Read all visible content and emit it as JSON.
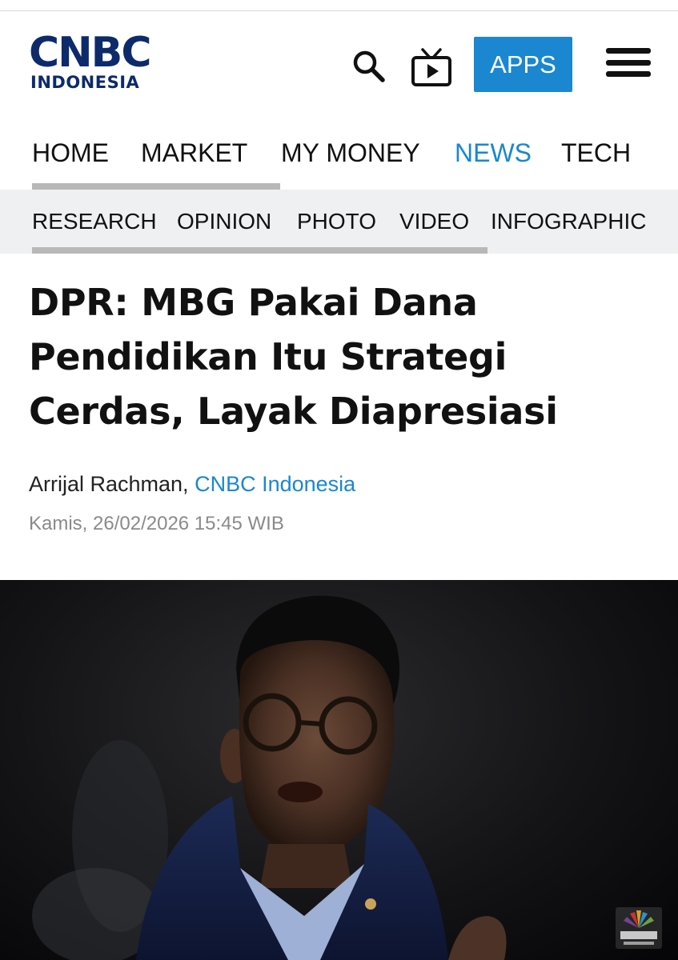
{
  "header": {
    "logo_top": "CNBC",
    "logo_bottom": "INDONESIA",
    "apps_label": "APPS",
    "icons": [
      "search-icon",
      "tv-icon",
      "menu-icon"
    ]
  },
  "nav_primary": {
    "items": [
      "HOME",
      "MARKET",
      "MY MONEY",
      "NEWS",
      "TECH"
    ],
    "active": "NEWS"
  },
  "nav_secondary": {
    "items": [
      "RESEARCH",
      "OPINION",
      "PHOTO",
      "VIDEO",
      "INFOGRAPHIC"
    ]
  },
  "article": {
    "headline": "DPR: MBG Pakai Dana Pendidikan Itu Strategi Cerdas, Layak Diapresiasi",
    "author": "Arrijal Rachman,",
    "publisher": "CNBC Indonesia",
    "date": "Kamis, 26/02/2026 15:45 WIB"
  },
  "photo": {
    "watermark": "CNBC INDONESIA"
  },
  "colors": {
    "brand_navy": "#0d2a6b",
    "accent_blue": "#1a87d0",
    "subnav_bg": "#eff0f1"
  }
}
